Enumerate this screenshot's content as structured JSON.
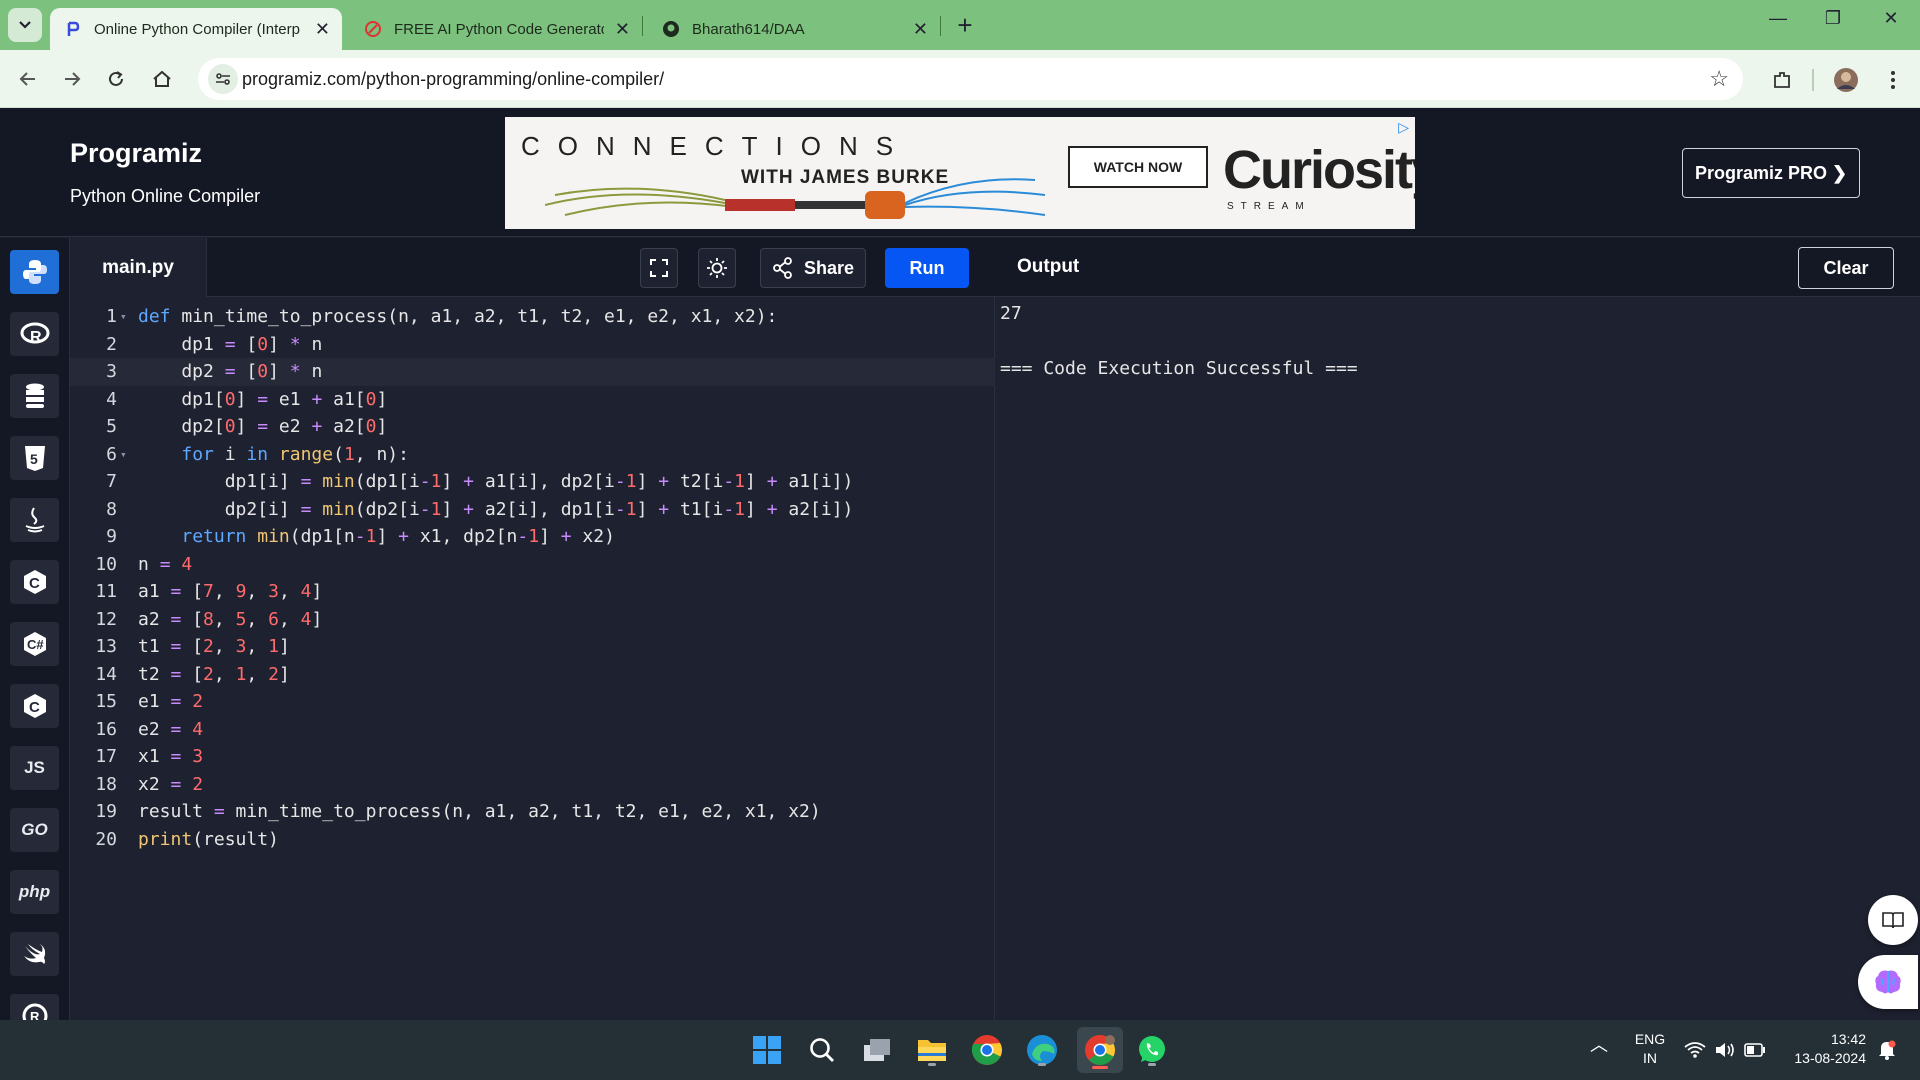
{
  "browser": {
    "tabs": [
      {
        "title": "Online Python Compiler (Interp",
        "active": true,
        "icon": "programiz-favicon-icon"
      },
      {
        "title": "FREE AI Python Code Generator",
        "active": false,
        "icon": "ai-generator-favicon-icon"
      },
      {
        "title": "Bharath614/DAA",
        "active": false,
        "icon": "github-favicon-icon"
      }
    ],
    "url": "programiz.com/python-programming/online-compiler/"
  },
  "header": {
    "logo": "Programiz",
    "subtitle": "Python Online Compiler",
    "pro_button": "Programiz PRO ❯",
    "ad": {
      "title": "CONNECTIONS",
      "subtitle": "WITH JAMES BURKE",
      "cta": "WATCH NOW",
      "brand": "Curiosity",
      "brand_sub": "STREAM"
    }
  },
  "rail": {
    "items": [
      "python",
      "r",
      "sql",
      "html",
      "java",
      "c",
      "csharp",
      "cpp",
      "JS",
      "GO",
      "php",
      "swift",
      "rust"
    ]
  },
  "editor": {
    "filename": "main.py",
    "share_label": "Share",
    "run_label": "Run",
    "cursor_line": 3,
    "lines": [
      "def min_time_to_process(n, a1, a2, t1, t2, e1, e2, x1, x2):",
      "    dp1 = [0] * n",
      "    dp2 = [0] * n",
      "    dp1[0] = e1 + a1[0]",
      "    dp2[0] = e2 + a2[0]",
      "    for i in range(1, n):",
      "        dp1[i] = min(dp1[i-1] + a1[i], dp2[i-1] + t2[i-1] + a1[i])",
      "        dp2[i] = min(dp2[i-1] + a2[i], dp1[i-1] + t1[i-1] + a2[i])",
      "    return min(dp1[n-1] + x1, dp2[n-1] + x2)",
      "n = 4",
      "a1 = [7, 9, 3, 4]",
      "a2 = [8, 5, 6, 4]",
      "t1 = [2, 3, 1]",
      "t2 = [2, 1, 2]",
      "e1 = 2",
      "e2 = 4",
      "x1 = 3",
      "x2 = 2",
      "result = min_time_to_process(n, a1, a2, t1, t2, e1, e2, x1, x2)",
      "print(result)"
    ],
    "fold_lines": [
      1,
      6
    ]
  },
  "output": {
    "title": "Output",
    "clear_label": "Clear",
    "lines": [
      "27",
      "",
      "=== Code Execution Successful ==="
    ]
  },
  "taskbar": {
    "apps": [
      "windows-start-icon",
      "search-icon",
      "task-view-icon",
      "file-explorer-icon",
      "chrome-icon",
      "edge-icon",
      "chrome-profile-icon",
      "whatsapp-icon"
    ],
    "lang": "ENG",
    "region": "IN",
    "time": "13:42",
    "date": "13-08-2024"
  },
  "colors": {
    "tab_bar": "#7cc17d",
    "run_button": "#0556f3",
    "keyword": "#5fa8ff",
    "number": "#ff6b6b",
    "operator": "#c98cff",
    "builtin": "#f0c674"
  }
}
